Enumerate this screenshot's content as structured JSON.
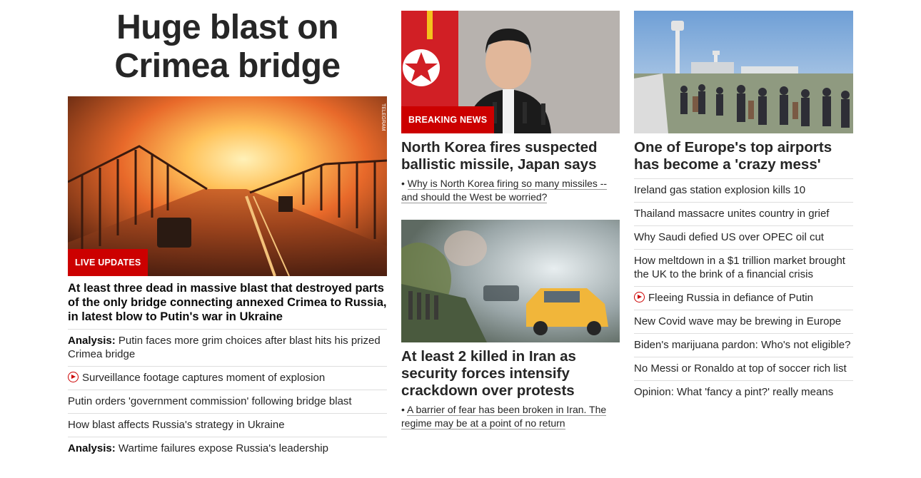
{
  "mega_title": "Huge blast on Crimea bridge",
  "col1": {
    "image_credit": "TELEGRAM",
    "badge": "LIVE UPDATES",
    "headline": "At least three dead in massive blast that destroyed parts of the only bridge connecting annexed Crimea to Russia, in latest blow to Putin's war in Ukraine",
    "links": [
      {
        "prefix": "Analysis:",
        "text": " Putin faces more grim choices after blast hits his prized Crimea bridge",
        "video": false
      },
      {
        "prefix": "",
        "text": "Surveillance footage captures moment of explosion",
        "video": true
      },
      {
        "prefix": "",
        "text": "Putin orders 'government commission' following bridge blast",
        "video": false
      },
      {
        "prefix": "",
        "text": "How blast affects Russia's strategy in Ukraine",
        "video": false
      },
      {
        "prefix": "Analysis:",
        "text": " Wartime failures expose Russia's leadership",
        "video": false
      }
    ]
  },
  "col2": {
    "story1": {
      "badge": "BREAKING NEWS",
      "headline": "North Korea fires suspected ballistic missile, Japan says",
      "sublink": "Why is North Korea firing so many missiles -- and should the West be worried?"
    },
    "story2": {
      "headline": "At least 2 killed in Iran as security forces intensify crackdown over protests",
      "sublink": "A barrier of fear has been broken in Iran. The regime may be at a point of no return"
    }
  },
  "col3": {
    "headline": "One of Europe's top airports has become a 'crazy mess'",
    "links": [
      {
        "text": "Ireland gas station explosion kills 10",
        "video": false
      },
      {
        "text": "Thailand massacre unites country in grief",
        "video": false
      },
      {
        "text": "Why Saudi defied US over OPEC oil cut",
        "video": false
      },
      {
        "text": "How meltdown in a $1 trillion market brought the UK to the brink of a financial crisis",
        "video": false
      },
      {
        "text": "Fleeing Russia in defiance of Putin",
        "video": true
      },
      {
        "text": "New Covid wave may be brewing in Europe",
        "video": false
      },
      {
        "text": "Biden's marijuana pardon: Who's not eligible?",
        "video": false
      },
      {
        "text": "No Messi or Ronaldo at top of soccer rich list",
        "video": false
      },
      {
        "text": "Opinion: What 'fancy a pint?' really means",
        "video": false
      }
    ]
  },
  "colors": {
    "accent_red": "#cc0000",
    "text": "#262626",
    "divider": "#dedede"
  }
}
